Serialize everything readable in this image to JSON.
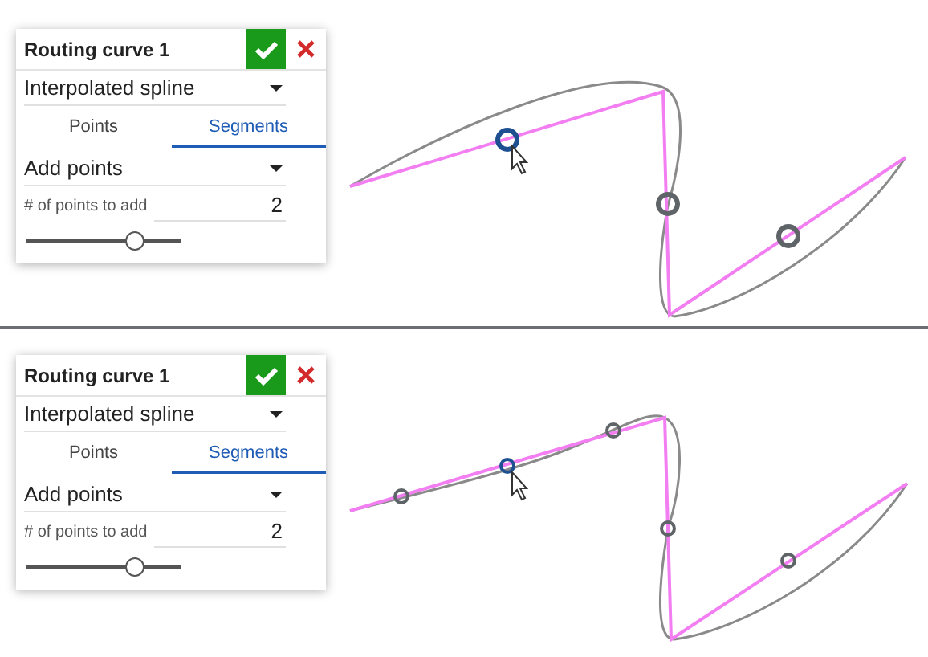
{
  "panels": [
    {
      "dialog": {
        "title": "Routing curve 1",
        "spline_type": "Interpolated spline",
        "tabs": [
          {
            "label": "Points",
            "selected": false
          },
          {
            "label": "Segments",
            "selected": true
          }
        ],
        "mode": "Add points",
        "count_label": "# of points to add",
        "count_value": "2",
        "slider": {
          "level": 0.7
        }
      }
    },
    {
      "dialog": {
        "title": "Routing curve 1",
        "spline_type": "Interpolated spline",
        "tabs": [
          {
            "label": "Points",
            "selected": false
          },
          {
            "label": "Segments",
            "selected": true
          }
        ],
        "mode": "Add points",
        "count_label": "# of points to add",
        "count_value": "2",
        "slider": {
          "level": 0.7
        }
      }
    }
  ]
}
